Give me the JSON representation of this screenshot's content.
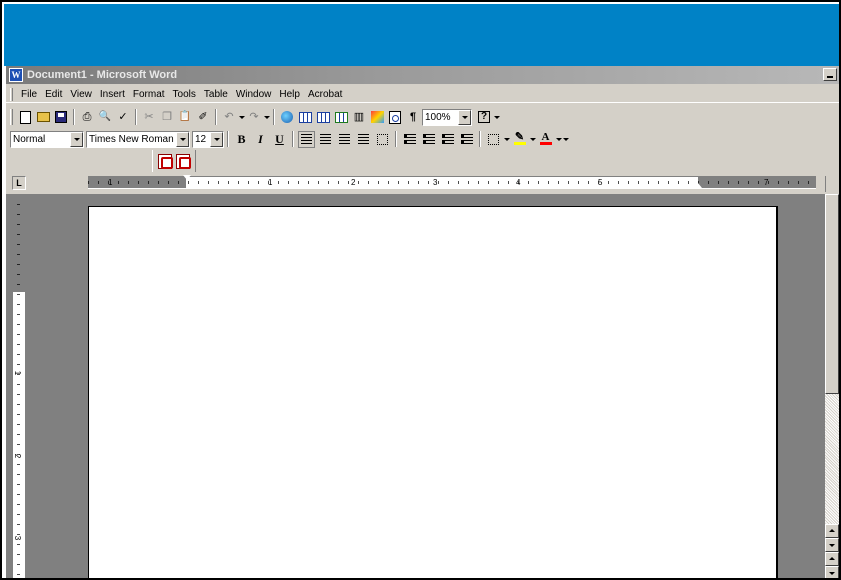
{
  "window": {
    "title": "Document1 - Microsoft Word",
    "app_icon": "word-icon",
    "app_icon_glyph": "W"
  },
  "menubar": {
    "items": [
      {
        "label": "File",
        "name": "menu-file"
      },
      {
        "label": "Edit",
        "name": "menu-edit"
      },
      {
        "label": "View",
        "name": "menu-view"
      },
      {
        "label": "Insert",
        "name": "menu-insert"
      },
      {
        "label": "Format",
        "name": "menu-format"
      },
      {
        "label": "Tools",
        "name": "menu-tools"
      },
      {
        "label": "Table",
        "name": "menu-table"
      },
      {
        "label": "Window",
        "name": "menu-window"
      },
      {
        "label": "Help",
        "name": "menu-help"
      },
      {
        "label": "Acrobat",
        "name": "menu-acrobat"
      }
    ]
  },
  "standard_toolbar": {
    "zoom": "100%",
    "show_hide_glyph": "¶",
    "help_glyph": "?",
    "undo_glyph": "↶",
    "redo_glyph": "↷",
    "cut_glyph": "✂",
    "spelling_glyph": "✓",
    "format_painter_glyph": "✐",
    "print_glyph": "⎙",
    "preview_glyph": "🔍",
    "copy_glyph": "❐",
    "paste_glyph": "📋",
    "columns_glyph": "▥",
    "drawing_glyph": "✎",
    "icons": [
      "new-document-icon",
      "open-folder-icon",
      "save-icon",
      "print-icon",
      "print-preview-icon",
      "spelling-icon",
      "cut-icon",
      "copy-icon",
      "paste-icon",
      "format-painter-icon",
      "undo-icon",
      "redo-icon",
      "hyperlink-globe-icon",
      "tables-borders-icon",
      "insert-table-icon",
      "insert-excel-icon",
      "columns-icon",
      "drawing-icon",
      "document-map-icon",
      "show-hide-icon",
      "help-icon"
    ]
  },
  "formatting_toolbar": {
    "style": "Normal",
    "font": "Times New Roman",
    "size": "12",
    "bold": "B",
    "italic": "I",
    "underline": "U",
    "highlight_glyph": "✎",
    "font_color_glyph": "A"
  },
  "acrobat_toolbar": {
    "icons": [
      "convert-to-pdf-icon",
      "convert-and-email-pdf-icon"
    ]
  },
  "ruler": {
    "tab_selector": "L",
    "horizontal_numbers": [
      "1",
      "1",
      "2",
      "3",
      "4",
      "5",
      "7"
    ],
    "vertical_numbers": [
      "1",
      "2",
      "3"
    ]
  },
  "colors": {
    "banner": "#0082c6",
    "chrome": "#d4d0c8",
    "workspace": "#808080",
    "page": "#ffffff"
  }
}
